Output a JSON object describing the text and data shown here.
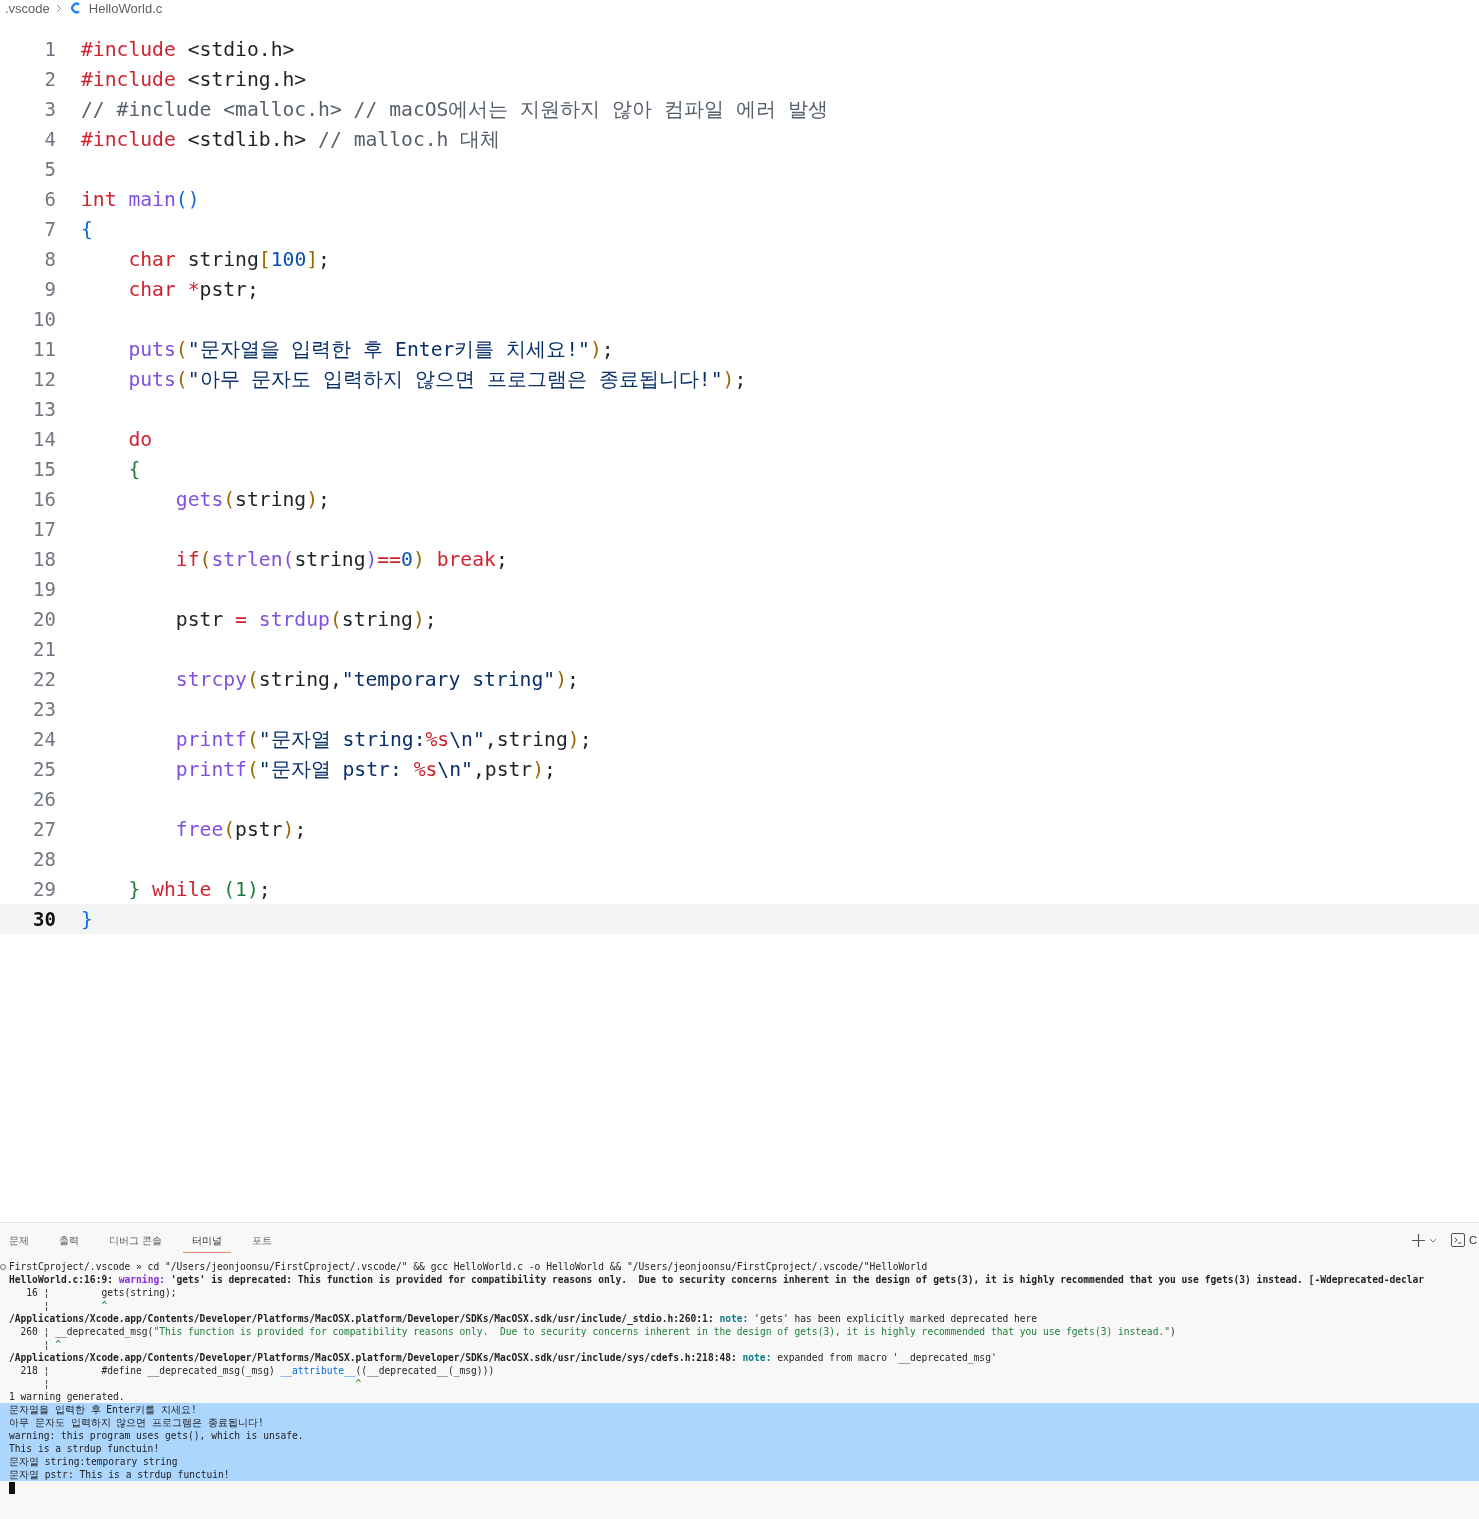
{
  "breadcrumb": {
    "folder": ".vscode",
    "file": "HelloWorld.c"
  },
  "editor": {
    "lines": [
      {
        "number": "1",
        "current": false,
        "tokens": [
          {
            "t": "#include",
            "kind": "kw"
          },
          {
            "t": " <stdio.h>",
            "kind": "plain"
          }
        ]
      },
      {
        "number": "2",
        "current": false,
        "tokens": [
          {
            "t": "#include",
            "kind": "kw"
          },
          {
            "t": " <string.h>",
            "kind": "plain"
          }
        ]
      },
      {
        "number": "3",
        "current": false,
        "tokens": [
          {
            "t": "// #include <malloc.h> // macOS에서는 지원하지 않아 컴파일 에러 발생",
            "kind": "comment"
          }
        ]
      },
      {
        "number": "4",
        "current": false,
        "tokens": [
          {
            "t": "#include",
            "kind": "kw"
          },
          {
            "t": " <stdlib.h> ",
            "kind": "plain"
          },
          {
            "t": "// malloc.h 대체",
            "kind": "comment"
          }
        ]
      },
      {
        "number": "5",
        "current": false
      },
      {
        "number": "6",
        "current": false,
        "tokens": [
          {
            "t": "int",
            "kind": "kw"
          },
          {
            "t": " main",
            "kind": "fn"
          },
          {
            "t": "()",
            "kind": "b1"
          }
        ]
      },
      {
        "number": "7",
        "current": false,
        "tokens": [
          {
            "t": "{",
            "kind": "b1"
          }
        ]
      },
      {
        "number": "8",
        "current": false,
        "tokens": [
          {
            "t": "    char",
            "kind": "kw"
          },
          {
            "t": " string",
            "kind": "plain"
          },
          {
            "t": "[",
            "kind": "b2"
          },
          {
            "t": "100",
            "kind": "num"
          },
          {
            "t": "]",
            "kind": "b2"
          },
          {
            "t": ";",
            "kind": "plain"
          }
        ]
      },
      {
        "number": "9",
        "current": false,
        "tokens": [
          {
            "t": "    char",
            "kind": "kw"
          },
          {
            "t": " *",
            "kind": "kw"
          },
          {
            "t": "pstr;",
            "kind": "plain"
          }
        ]
      },
      {
        "number": "10",
        "current": false
      },
      {
        "number": "11",
        "current": false,
        "tokens": [
          {
            "t": "    puts",
            "kind": "fn"
          },
          {
            "t": "(",
            "kind": "b2"
          },
          {
            "t": "\"문자열을 입력한 후 Enter키를 치세요!\"",
            "kind": "str"
          },
          {
            "t": ")",
            "kind": "b2"
          },
          {
            "t": ";",
            "kind": "plain"
          }
        ]
      },
      {
        "number": "12",
        "current": false,
        "tokens": [
          {
            "t": "    puts",
            "kind": "fn"
          },
          {
            "t": "(",
            "kind": "b2"
          },
          {
            "t": "\"아무 문자도 입력하지 않으면 프로그램은 종료됩니다!\"",
            "kind": "str"
          },
          {
            "t": ")",
            "kind": "b2"
          },
          {
            "t": ";",
            "kind": "plain"
          }
        ]
      },
      {
        "number": "13",
        "current": false
      },
      {
        "number": "14",
        "current": false,
        "tokens": [
          {
            "t": "    do",
            "kind": "kw"
          }
        ]
      },
      {
        "number": "15",
        "current": false,
        "tokens": [
          {
            "t": "    {",
            "kind": "b3"
          }
        ]
      },
      {
        "number": "16",
        "current": false,
        "tokens": [
          {
            "t": "        gets",
            "kind": "fn"
          },
          {
            "t": "(",
            "kind": "b2"
          },
          {
            "t": "string",
            "kind": "plain"
          },
          {
            "t": ")",
            "kind": "b2"
          },
          {
            "t": ";",
            "kind": "plain"
          }
        ]
      },
      {
        "number": "17",
        "current": false
      },
      {
        "number": "18",
        "current": false,
        "tokens": [
          {
            "t": "        if",
            "kind": "kw"
          },
          {
            "t": "(",
            "kind": "b2"
          },
          {
            "t": "strlen",
            "kind": "fn"
          },
          {
            "t": "(",
            "kind": "b4"
          },
          {
            "t": "string",
            "kind": "plain"
          },
          {
            "t": ")",
            "kind": "b4"
          },
          {
            "t": "==",
            "kind": "kw"
          },
          {
            "t": "0",
            "kind": "num"
          },
          {
            "t": ")",
            "kind": "b2"
          },
          {
            "t": " break",
            "kind": "kw"
          },
          {
            "t": ";",
            "kind": "plain"
          }
        ]
      },
      {
        "number": "19",
        "current": false
      },
      {
        "number": "20",
        "current": false,
        "tokens": [
          {
            "t": "        pstr ",
            "kind": "plain"
          },
          {
            "t": "=",
            "kind": "kw"
          },
          {
            "t": " strdup",
            "kind": "fn"
          },
          {
            "t": "(",
            "kind": "b2"
          },
          {
            "t": "string",
            "kind": "plain"
          },
          {
            "t": ")",
            "kind": "b2"
          },
          {
            "t": ";",
            "kind": "plain"
          }
        ]
      },
      {
        "number": "21",
        "current": false
      },
      {
        "number": "22",
        "current": false,
        "tokens": [
          {
            "t": "        strcpy",
            "kind": "fn"
          },
          {
            "t": "(",
            "kind": "b2"
          },
          {
            "t": "string,",
            "kind": "plain"
          },
          {
            "t": "\"temporary string\"",
            "kind": "str"
          },
          {
            "t": ")",
            "kind": "b2"
          },
          {
            "t": ";",
            "kind": "plain"
          }
        ]
      },
      {
        "number": "23",
        "current": false
      },
      {
        "number": "24",
        "current": false,
        "tokens": [
          {
            "t": "        printf",
            "kind": "fn"
          },
          {
            "t": "(",
            "kind": "b2"
          },
          {
            "t": "\"문자열 string:",
            "kind": "str"
          },
          {
            "t": "%s",
            "kind": "ph"
          },
          {
            "t": "\\n\"",
            "kind": "str"
          },
          {
            "t": ",string",
            "kind": "plain"
          },
          {
            "t": ")",
            "kind": "b2"
          },
          {
            "t": ";",
            "kind": "plain"
          }
        ]
      },
      {
        "number": "25",
        "current": false,
        "tokens": [
          {
            "t": "        printf",
            "kind": "fn"
          },
          {
            "t": "(",
            "kind": "b2"
          },
          {
            "t": "\"문자열 pstr: ",
            "kind": "str"
          },
          {
            "t": "%s",
            "kind": "ph"
          },
          {
            "t": "\\n\"",
            "kind": "str"
          },
          {
            "t": ",pstr",
            "kind": "plain"
          },
          {
            "t": ")",
            "kind": "b2"
          },
          {
            "t": ";",
            "kind": "plain"
          }
        ]
      },
      {
        "number": "26",
        "current": false
      },
      {
        "number": "27",
        "current": false,
        "tokens": [
          {
            "t": "        free",
            "kind": "fn"
          },
          {
            "t": "(",
            "kind": "b2"
          },
          {
            "t": "pstr",
            "kind": "plain"
          },
          {
            "t": ")",
            "kind": "b2"
          },
          {
            "t": ";",
            "kind": "plain"
          }
        ]
      },
      {
        "number": "28",
        "current": false
      },
      {
        "number": "29",
        "current": false,
        "tokens": [
          {
            "t": "    }",
            "kind": "b3"
          },
          {
            "t": " while",
            "kind": "kw"
          },
          {
            "t": " (1)",
            "kind": "b3"
          },
          {
            "t": ";",
            "kind": "plain"
          }
        ]
      },
      {
        "number": "30",
        "current": true,
        "tokens": [
          {
            "t": "}",
            "kind": "b1"
          }
        ]
      }
    ]
  },
  "panel": {
    "tabs": [
      {
        "label": "문제",
        "selected": false
      },
      {
        "label": "출력",
        "selected": false
      },
      {
        "label": "디버그 콘솔",
        "selected": false
      },
      {
        "label": "터미널",
        "selected": true
      },
      {
        "label": "포트",
        "selected": false
      }
    ],
    "terminal_name": "C",
    "terminal": [
      {
        "kind": "command",
        "selected": false,
        "segments": [
          {
            "t": "FirstCproject/.vscode » cd \"/Users/jeonjoonsu/FirstCproject/.vscode/\" && gcc HelloWorld.c -o HelloWorld && \"/Users/jeonjoonsu/FirstCproject/.vscode/\"HelloWorld",
            "kind": "plain"
          }
        ]
      },
      {
        "kind": "output",
        "selected": false,
        "segments": [
          {
            "t": "HelloWorld.c:16:9: ",
            "kind": "bold"
          },
          {
            "t": "warning:",
            "kind": "warn"
          },
          {
            "t": " 'gets' is deprecated: This function is provided for compatibility reasons only.  Due to security concerns inherent in the design of gets(3), it is highly recommended that you use fgets(3) instead. [-Wdeprecated-declar",
            "kind": "bold"
          }
        ]
      },
      {
        "kind": "output",
        "selected": false,
        "segments": [
          {
            "t": "   16 ¦         gets(string);",
            "kind": "plain"
          }
        ]
      },
      {
        "kind": "output",
        "selected": false,
        "segments": [
          {
            "t": "      ¦",
            "kind": "plain"
          },
          {
            "t": "         ^",
            "kind": "green"
          }
        ]
      },
      {
        "kind": "output",
        "selected": false,
        "segments": [
          {
            "t": "/Applications/Xcode.app/Contents/Developer/Platforms/MacOSX.platform/Developer/SDKs/MacOSX.sdk/usr/include/_stdio.h:260:1: ",
            "kind": "bold"
          },
          {
            "t": "note:",
            "kind": "note"
          },
          {
            "t": " 'gets' has been explicitly marked deprecated here",
            "kind": "plain"
          }
        ]
      },
      {
        "kind": "output",
        "selected": false,
        "segments": [
          {
            "t": "  260 ¦ __deprecated_msg(",
            "kind": "plain"
          },
          {
            "t": "\"This function is provided for compatibility reasons only.  Due to security concerns inherent in the design of gets(3), it is highly recommended that you use fgets(3) instead.\"",
            "kind": "green"
          },
          {
            "t": ")",
            "kind": "plain"
          }
        ]
      },
      {
        "kind": "output",
        "selected": false,
        "segments": [
          {
            "t": "      ¦",
            "kind": "plain"
          },
          {
            "t": " ^",
            "kind": "green"
          }
        ]
      },
      {
        "kind": "output",
        "selected": false,
        "segments": [
          {
            "t": "/Applications/Xcode.app/Contents/Developer/Platforms/MacOSX.platform/Developer/SDKs/MacOSX.sdk/usr/include/sys/cdefs.h:218:48: ",
            "kind": "bold"
          },
          {
            "t": "note:",
            "kind": "note"
          },
          {
            "t": " expanded from macro '__deprecated_msg'",
            "kind": "plain"
          }
        ]
      },
      {
        "kind": "output",
        "selected": false,
        "segments": [
          {
            "t": "  218 ¦         #define __deprecated_msg(_msg) ",
            "kind": "plain"
          },
          {
            "t": "__attribute__",
            "kind": "blue"
          },
          {
            "t": "((__deprecated__(_msg)))",
            "kind": "plain"
          }
        ]
      },
      {
        "kind": "output",
        "selected": false,
        "segments": [
          {
            "t": "      ¦",
            "kind": "plain"
          },
          {
            "t": "                                                     ^",
            "kind": "green"
          }
        ]
      },
      {
        "kind": "output",
        "selected": false,
        "segments": [
          {
            "t": "1 warning generated.",
            "kind": "plain"
          }
        ]
      },
      {
        "kind": "output",
        "selected": true,
        "segments": [
          {
            "t": "문자열을 입력한 후 Enter키를 치세요!",
            "kind": "plain"
          }
        ]
      },
      {
        "kind": "output",
        "selected": true,
        "segments": [
          {
            "t": "아무 문자도 입력하지 않으면 프로그램은 종료됩니다!",
            "kind": "plain"
          }
        ]
      },
      {
        "kind": "output",
        "selected": true,
        "segments": [
          {
            "t": "warning: this program uses gets(), which is unsafe.",
            "kind": "plain"
          }
        ]
      },
      {
        "kind": "output",
        "selected": true,
        "segments": [
          {
            "t": "This is a strdup functuin!",
            "kind": "plain"
          }
        ]
      },
      {
        "kind": "output",
        "selected": true,
        "segments": [
          {
            "t": "문자열 string:temporary string",
            "kind": "plain"
          }
        ]
      },
      {
        "kind": "output",
        "selected": true,
        "segments": [
          {
            "t": "문자열 pstr: This is a strdup functuin!",
            "kind": "plain"
          }
        ]
      },
      {
        "kind": "cursor",
        "selected": false
      }
    ]
  }
}
